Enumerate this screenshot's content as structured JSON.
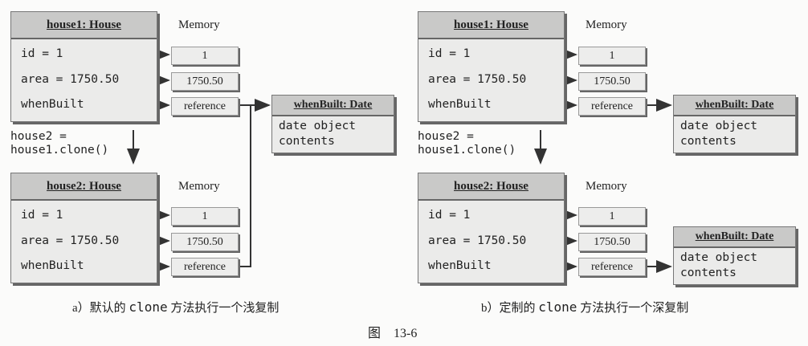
{
  "memory_label": "Memory",
  "house1": {
    "title": "house1: House",
    "fields": [
      "id = 1",
      "area = 1750.50",
      "whenBuilt"
    ]
  },
  "house2": {
    "title": "house2: House",
    "fields": [
      "id = 1",
      "area = 1750.50",
      "whenBuilt"
    ]
  },
  "memory_values": [
    "1",
    "1750.50",
    "reference"
  ],
  "clone_stmt": [
    "house2 =",
    "house1.clone()"
  ],
  "date_obj": {
    "title": "whenBuilt: Date",
    "body": [
      "date object",
      "contents"
    ]
  },
  "captions": {
    "a_prefix": "a）默认的 ",
    "a_code": "clone",
    "a_suffix": " 方法执行一个浅复制",
    "b_prefix": "b）定制的 ",
    "b_code": "clone",
    "b_suffix": " 方法执行一个深复制"
  },
  "figure_label": "图　13-6"
}
